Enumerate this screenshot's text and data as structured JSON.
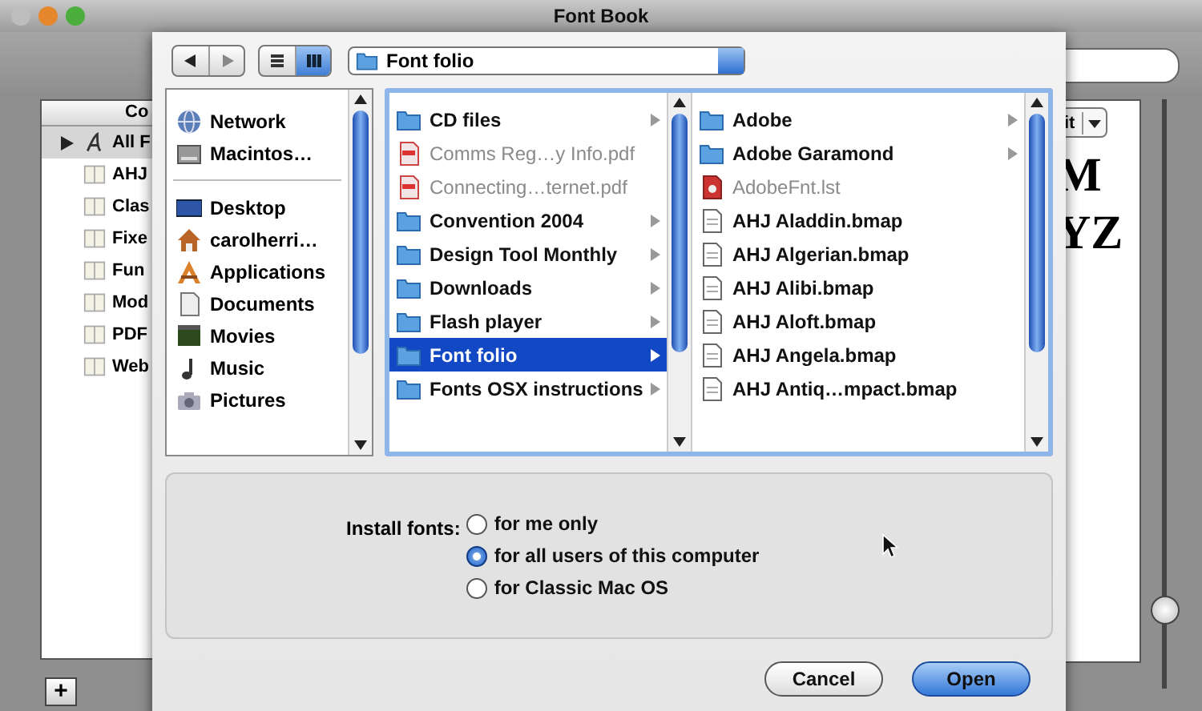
{
  "window": {
    "title": "Font Book"
  },
  "collections": {
    "header": "Co",
    "items": [
      {
        "label": "All F",
        "kind": "all",
        "selected": true
      },
      {
        "label": "AHJ",
        "kind": "book",
        "selected": false
      },
      {
        "label": "Clas",
        "kind": "book",
        "selected": false
      },
      {
        "label": "Fixe",
        "kind": "book",
        "selected": false
      },
      {
        "label": "Fun",
        "kind": "book",
        "selected": false
      },
      {
        "label": "Mod",
        "kind": "book",
        "selected": false
      },
      {
        "label": "PDF",
        "kind": "book",
        "selected": false
      },
      {
        "label": "Web",
        "kind": "book",
        "selected": false
      }
    ]
  },
  "preview": {
    "size_popup": "it",
    "sample_lines": [
      "M",
      "YZ"
    ],
    "size_slider": {
      "level": 0.13
    }
  },
  "add_button": "+",
  "sheet": {
    "location": "Font folio",
    "view_buttons": [
      {
        "kind": "list",
        "selected": false
      },
      {
        "kind": "columns",
        "selected": true
      }
    ],
    "sidebar": [
      {
        "items": [
          {
            "label": "Network",
            "kind": "network"
          },
          {
            "label": "Macintos…",
            "kind": "disk"
          }
        ]
      },
      {
        "items": [
          {
            "label": "Desktop",
            "kind": "desktop"
          },
          {
            "label": "carolherri…",
            "kind": "home"
          },
          {
            "label": "Applications",
            "kind": "applications"
          },
          {
            "label": "Documents",
            "kind": "documents"
          },
          {
            "label": "Movies",
            "kind": "movies"
          },
          {
            "label": "Music",
            "kind": "music"
          },
          {
            "label": "Pictures",
            "kind": "pictures"
          }
        ]
      }
    ],
    "columns": [
      {
        "items": [
          {
            "label": "CD files",
            "kind": "folder",
            "has_children": true,
            "disabled": false,
            "selected": false
          },
          {
            "label": "Comms Reg…y Info.pdf",
            "kind": "pdf",
            "has_children": false,
            "disabled": true,
            "selected": false
          },
          {
            "label": "Connecting…ternet.pdf",
            "kind": "pdf",
            "has_children": false,
            "disabled": true,
            "selected": false
          },
          {
            "label": "Convention 2004",
            "kind": "folder",
            "has_children": true,
            "disabled": false,
            "selected": false
          },
          {
            "label": "Design Tool Monthly",
            "kind": "folder",
            "has_children": true,
            "disabled": false,
            "selected": false
          },
          {
            "label": "Downloads",
            "kind": "folder",
            "has_children": true,
            "disabled": false,
            "selected": false
          },
          {
            "label": "Flash player",
            "kind": "folder",
            "has_children": true,
            "disabled": false,
            "selected": false
          },
          {
            "label": "Font folio",
            "kind": "folder",
            "has_children": true,
            "disabled": false,
            "selected": true
          },
          {
            "label": "Fonts OSX instructions",
            "kind": "folder",
            "has_children": true,
            "disabled": false,
            "selected": false
          }
        ]
      },
      {
        "items": [
          {
            "label": "Adobe",
            "kind": "folder",
            "has_children": true,
            "disabled": false,
            "selected": false
          },
          {
            "label": "Adobe Garamond",
            "kind": "folder",
            "has_children": true,
            "disabled": false,
            "selected": false
          },
          {
            "label": "AdobeFnt.lst",
            "kind": "fontlist",
            "has_children": false,
            "disabled": true,
            "selected": false
          },
          {
            "label": "AHJ Aladdin.bmap",
            "kind": "file",
            "has_children": false,
            "disabled": false,
            "selected": false
          },
          {
            "label": "AHJ Algerian.bmap",
            "kind": "file",
            "has_children": false,
            "disabled": false,
            "selected": false
          },
          {
            "label": "AHJ Alibi.bmap",
            "kind": "file",
            "has_children": false,
            "disabled": false,
            "selected": false
          },
          {
            "label": "AHJ Aloft.bmap",
            "kind": "file",
            "has_children": false,
            "disabled": false,
            "selected": false
          },
          {
            "label": "AHJ Angela.bmap",
            "kind": "file",
            "has_children": false,
            "disabled": false,
            "selected": false
          },
          {
            "label": "AHJ Antiq…mpact.bmap",
            "kind": "file",
            "has_children": false,
            "disabled": false,
            "selected": false
          }
        ]
      }
    ],
    "install": {
      "label": "Install fonts:",
      "options": [
        {
          "label": "for me only",
          "selected": false
        },
        {
          "label": "for all users of this computer",
          "selected": true
        },
        {
          "label": "for Classic Mac OS",
          "selected": false
        }
      ]
    },
    "buttons": [
      {
        "label": "Cancel",
        "default": false
      },
      {
        "label": "Open",
        "default": true
      }
    ]
  }
}
